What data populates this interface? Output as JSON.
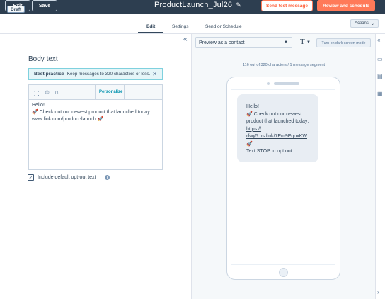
{
  "topbar": {
    "exit_label": "Exit",
    "save_label": "Save",
    "title": "ProductLaunch_Jul26",
    "send_test_label": "Send test message",
    "review_label": "Review and schedule"
  },
  "subbar": {
    "status_badge": "Draft",
    "tabs": [
      {
        "label": "Edit",
        "active": true
      },
      {
        "label": "Settings",
        "active": false
      },
      {
        "label": "Send or Schedule",
        "active": false
      }
    ],
    "actions_label": "Actions"
  },
  "editor": {
    "section_title": "Body text",
    "best_practice_title": "Best practice",
    "best_practice_text": "Keep messages to 320 characters or less.",
    "personalize_label": "Personalize",
    "body_lines": [
      "Hello!",
      "🚀 Check out our newest product that launched today:",
      "www.link.com/product-launch 🚀"
    ],
    "optout_label": "Include default opt-out text",
    "optout_checked": true
  },
  "preview": {
    "select_value": "Preview as a contact",
    "dark_mode_label": "Turn on dark screen mode",
    "char_count": "116 out of 320 characters / 1 message segment",
    "message_lines": [
      "Hello!",
      "🚀 Check out our newest product that launched today:"
    ],
    "message_link_line1": "https://",
    "message_link_line2": "rfwy5.hs.link/7Em9EqoxKW",
    "message_rocket": "🚀",
    "message_footer": "Text STOP to opt out"
  },
  "colors": {
    "topbar_bg": "#2d3e50",
    "accent_orange": "#ff7a59",
    "best_practice_bg": "#e5f5f8",
    "bubble_bg": "#e8edf3"
  },
  "icons": [
    "pencil-icon",
    "chevron-down-icon",
    "double-chevron-left-icon",
    "emoji-icon",
    "snippet-icon",
    "close-icon",
    "check-icon",
    "info-icon",
    "chat-icon",
    "calendar-icon",
    "chevron-right-icon"
  ]
}
